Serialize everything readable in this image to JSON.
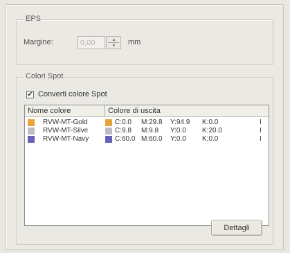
{
  "eps": {
    "title": "EPS",
    "margin_label": "Margine:",
    "margin_value": "0,00",
    "unit": "mm"
  },
  "spot": {
    "title": "Colori Spot",
    "convert_label": "Converti colore Spot",
    "convert_checked": "✔",
    "columns": [
      "Nome colore",
      "Colore di uscita"
    ],
    "rows": [
      {
        "name": "RVW-MT-Gold",
        "swatch": "#e8a43c",
        "c": "C:0.0",
        "m": "M:29.8",
        "y": "Y:94.9",
        "k": "K:0.0",
        "extra": "I"
      },
      {
        "name": "RVW-MT-Silve",
        "swatch": "#bfbcc8",
        "c": "C:9.8",
        "m": "M:9.8",
        "y": "Y:0.0",
        "k": "K:20.0",
        "extra": "I"
      },
      {
        "name": "RVW-MT-Navy",
        "swatch": "#6660b8",
        "c": "C:60.0",
        "m": "M:60.0",
        "y": "Y:0.0",
        "k": "K:0.0",
        "extra": "I"
      }
    ],
    "details_button": "Dettagli"
  }
}
